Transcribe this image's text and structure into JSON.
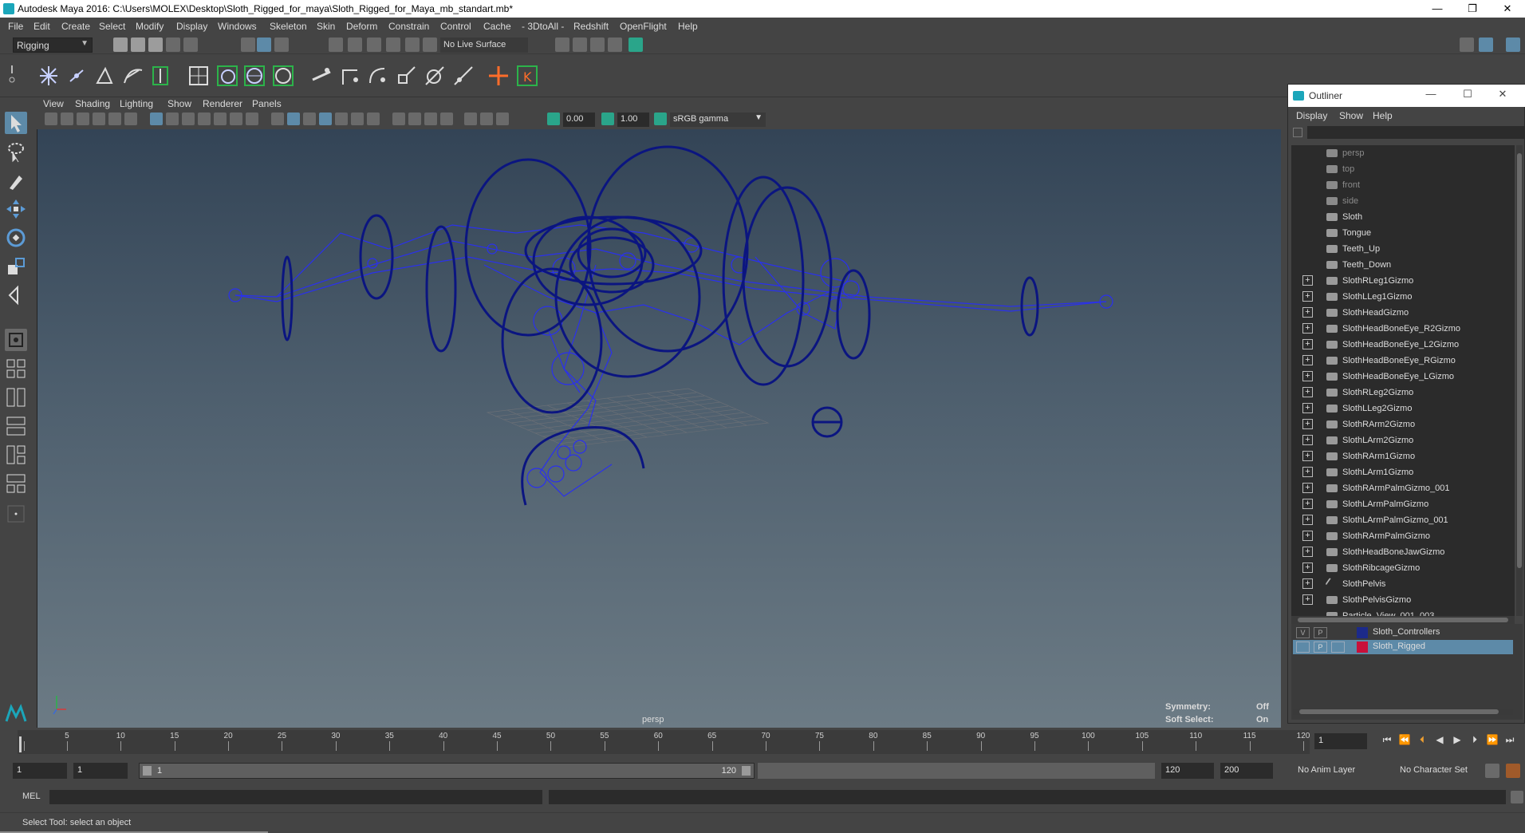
{
  "window": {
    "title": "Autodesk Maya 2016: C:\\Users\\MOLEX\\Desktop\\Sloth_Rigged_for_maya\\Sloth_Rigged_for_Maya_mb_standart.mb*",
    "minimize": "—",
    "restore": "❐",
    "close": "✕"
  },
  "menubar": [
    "File",
    "Edit",
    "Create",
    "Select",
    "Modify",
    "Display",
    "Windows",
    "Skeleton",
    "Skin",
    "Deform",
    "Constrain",
    "Control",
    "Cache",
    "- 3DtoAll -",
    "Redshift",
    "OpenFlight",
    "Help"
  ],
  "statusline": {
    "menuset": "Rigging",
    "live_surface": "No Live Surface"
  },
  "panel": {
    "menus": [
      "View",
      "Shading",
      "Lighting",
      "Show",
      "Renderer",
      "Panels"
    ],
    "exposure": "0.00",
    "gamma": "1.00",
    "colorspace": "sRGB gamma"
  },
  "viewport": {
    "camera": "persp",
    "symmetry_label": "Symmetry:",
    "symmetry_value": "Off",
    "soft_select_label": "Soft Select:",
    "soft_select_value": "On",
    "wire_color": "#0b1580",
    "joint_color": "#2a30ee"
  },
  "outliner": {
    "title": "Outliner",
    "menus": [
      "Display",
      "Show",
      "Help"
    ],
    "items": [
      {
        "label": "persp",
        "dim": true,
        "expand": false,
        "icon": "camera-icon"
      },
      {
        "label": "top",
        "dim": true,
        "expand": false,
        "icon": "camera-icon"
      },
      {
        "label": "front",
        "dim": true,
        "expand": false,
        "icon": "camera-icon"
      },
      {
        "label": "side",
        "dim": true,
        "expand": false,
        "icon": "camera-icon"
      },
      {
        "label": "Sloth",
        "dim": false,
        "expand": false,
        "icon": "mesh-icon"
      },
      {
        "label": "Tongue",
        "dim": false,
        "expand": false,
        "icon": "mesh-icon"
      },
      {
        "label": "Teeth_Up",
        "dim": false,
        "expand": false,
        "icon": "mesh-icon"
      },
      {
        "label": "Teeth_Down",
        "dim": false,
        "expand": false,
        "icon": "mesh-icon"
      },
      {
        "label": "SlothRLeg1Gizmo",
        "dim": false,
        "expand": true,
        "icon": "mesh-icon"
      },
      {
        "label": "SlothLLeg1Gizmo",
        "dim": false,
        "expand": true,
        "icon": "mesh-icon"
      },
      {
        "label": "SlothHeadGizmo",
        "dim": false,
        "expand": true,
        "icon": "mesh-icon"
      },
      {
        "label": "SlothHeadBoneEye_R2Gizmo",
        "dim": false,
        "expand": true,
        "icon": "mesh-icon"
      },
      {
        "label": "SlothHeadBoneEye_L2Gizmo",
        "dim": false,
        "expand": true,
        "icon": "mesh-icon"
      },
      {
        "label": "SlothHeadBoneEye_RGizmo",
        "dim": false,
        "expand": true,
        "icon": "mesh-icon"
      },
      {
        "label": "SlothHeadBoneEye_LGizmo",
        "dim": false,
        "expand": true,
        "icon": "mesh-icon"
      },
      {
        "label": "SlothRLeg2Gizmo",
        "dim": false,
        "expand": true,
        "icon": "mesh-icon"
      },
      {
        "label": "SlothLLeg2Gizmo",
        "dim": false,
        "expand": true,
        "icon": "mesh-icon"
      },
      {
        "label": "SlothRArm2Gizmo",
        "dim": false,
        "expand": true,
        "icon": "mesh-icon"
      },
      {
        "label": "SlothLArm2Gizmo",
        "dim": false,
        "expand": true,
        "icon": "mesh-icon"
      },
      {
        "label": "SlothRArm1Gizmo",
        "dim": false,
        "expand": true,
        "icon": "mesh-icon"
      },
      {
        "label": "SlothLArm1Gizmo",
        "dim": false,
        "expand": true,
        "icon": "mesh-icon"
      },
      {
        "label": "SlothRArmPalmGizmo_001",
        "dim": false,
        "expand": true,
        "icon": "mesh-icon"
      },
      {
        "label": "SlothLArmPalmGizmo",
        "dim": false,
        "expand": true,
        "icon": "mesh-icon"
      },
      {
        "label": "SlothLArmPalmGizmo_001",
        "dim": false,
        "expand": true,
        "icon": "mesh-icon"
      },
      {
        "label": "SlothRArmPalmGizmo",
        "dim": false,
        "expand": true,
        "icon": "mesh-icon"
      },
      {
        "label": "SlothHeadBoneJawGizmo",
        "dim": false,
        "expand": true,
        "icon": "mesh-icon"
      },
      {
        "label": "SlothRibcageGizmo",
        "dim": false,
        "expand": true,
        "icon": "mesh-icon"
      },
      {
        "label": "SlothPelvis",
        "dim": false,
        "expand": true,
        "icon": "joint-icon"
      },
      {
        "label": "SlothPelvisGizmo",
        "dim": false,
        "expand": true,
        "icon": "mesh-icon"
      },
      {
        "label": "Particle_View_001_003",
        "dim": false,
        "expand": false,
        "icon": "particle-icon"
      }
    ],
    "layers": [
      {
        "name": "Sloth_Controllers",
        "color": "#1c2a8a",
        "selected": false,
        "v": "V",
        "p": "P"
      },
      {
        "name": "Sloth_Rigged",
        "color": "#c8103a",
        "selected": true,
        "v": "",
        "p": "P"
      }
    ]
  },
  "timeline": {
    "ticks": [
      "1",
      "5",
      "10",
      "15",
      "20",
      "25",
      "30",
      "35",
      "40",
      "45",
      "50",
      "55",
      "60",
      "65",
      "70",
      "75",
      "80",
      "85",
      "90",
      "95",
      "100",
      "105",
      "110",
      "115",
      "120"
    ],
    "current_frame": "1"
  },
  "range": {
    "start": "1",
    "inner_start": "1",
    "slider_start": "1",
    "slider_end": "120",
    "inner_end": "120",
    "end": "200",
    "anim_layer": "No Anim Layer",
    "character_set": "No Character Set"
  },
  "cmdline": {
    "label": "MEL"
  },
  "helpline": {
    "text": "Select Tool: select an object"
  }
}
